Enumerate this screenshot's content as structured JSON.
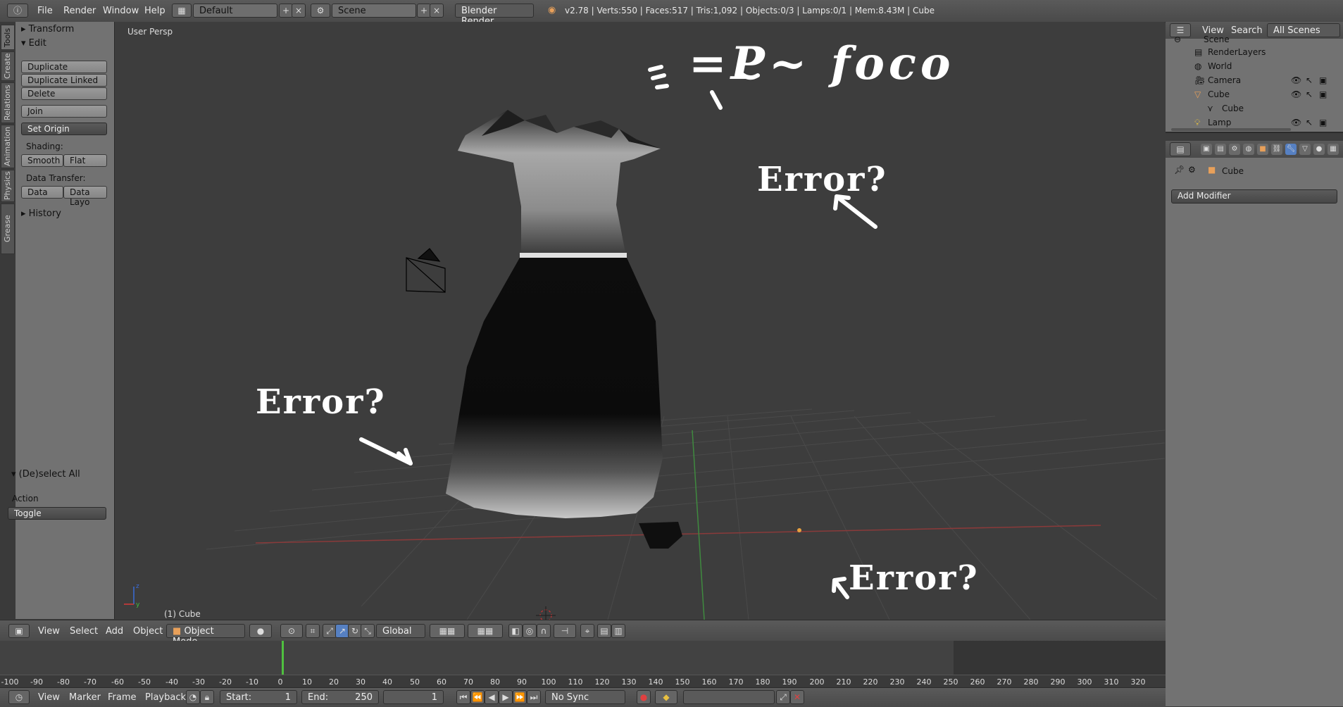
{
  "topbar": {
    "menus": [
      "File",
      "Render",
      "Window",
      "Help"
    ],
    "layout_name": "Default",
    "scene_name": "Scene",
    "engine": "Blender Render",
    "stats": "v2.78 | Verts:550 | Faces:517 | Tris:1,092 | Objects:0/3 | Lamps:0/1 | Mem:8.43M | Cube"
  },
  "left_tabs": [
    "Tools",
    "Create",
    "Relations",
    "Animation",
    "Physics",
    "Grease Pencil"
  ],
  "toolpanel": {
    "transform": "Transform",
    "edit": "Edit",
    "duplicate": "Duplicate",
    "duplicate_linked": "Duplicate Linked",
    "delete": "Delete",
    "join": "Join",
    "set_origin": "Set Origin",
    "shading_label": "Shading:",
    "smooth": "Smooth",
    "flat": "Flat",
    "data_transfer_label": "Data Transfer:",
    "data": "Data",
    "data_layout": "Data Layo",
    "history": "History",
    "operator_title": "(De)select All",
    "action_label": "Action",
    "action_value": "Toggle"
  },
  "viewport": {
    "view_name": "User Persp",
    "object_label": "(1) Cube",
    "annotations": [
      "Error?",
      "Error?",
      "Error?"
    ],
    "handwritten_top": "=P~ foco"
  },
  "view_header": {
    "menus": [
      "View",
      "Select",
      "Add",
      "Object"
    ],
    "mode": "Object Mode",
    "orientation": "Global"
  },
  "timeline": {
    "ticks": [
      "-100",
      "-90",
      "-80",
      "-70",
      "-60",
      "-50",
      "-40",
      "-30",
      "-20",
      "-10",
      "0",
      "10",
      "20",
      "30",
      "40",
      "50",
      "60",
      "70",
      "80",
      "90",
      "100",
      "110",
      "120",
      "130",
      "140",
      "150",
      "160",
      "170",
      "180",
      "190",
      "200",
      "210",
      "220",
      "230",
      "240",
      "250",
      "260",
      "270",
      "280",
      "290",
      "300",
      "310",
      "320"
    ],
    "menus": [
      "View",
      "Marker",
      "Frame",
      "Playback"
    ],
    "start_label": "Start:",
    "start_value": "1",
    "end_label": "End:",
    "end_value": "250",
    "current_frame": "1",
    "sync": "No Sync"
  },
  "outliner": {
    "menus": [
      "View",
      "Search"
    ],
    "filter": "All Scenes",
    "rows": [
      "Scene",
      "RenderLayers",
      "World",
      "Camera",
      "Cube",
      "Cube",
      "Lamp"
    ]
  },
  "properties": {
    "object_name": "Cube",
    "add_modifier": "Add Modifier"
  },
  "colors": {
    "accent_blue": "#5680c2",
    "playhead": "#4fc03f"
  }
}
